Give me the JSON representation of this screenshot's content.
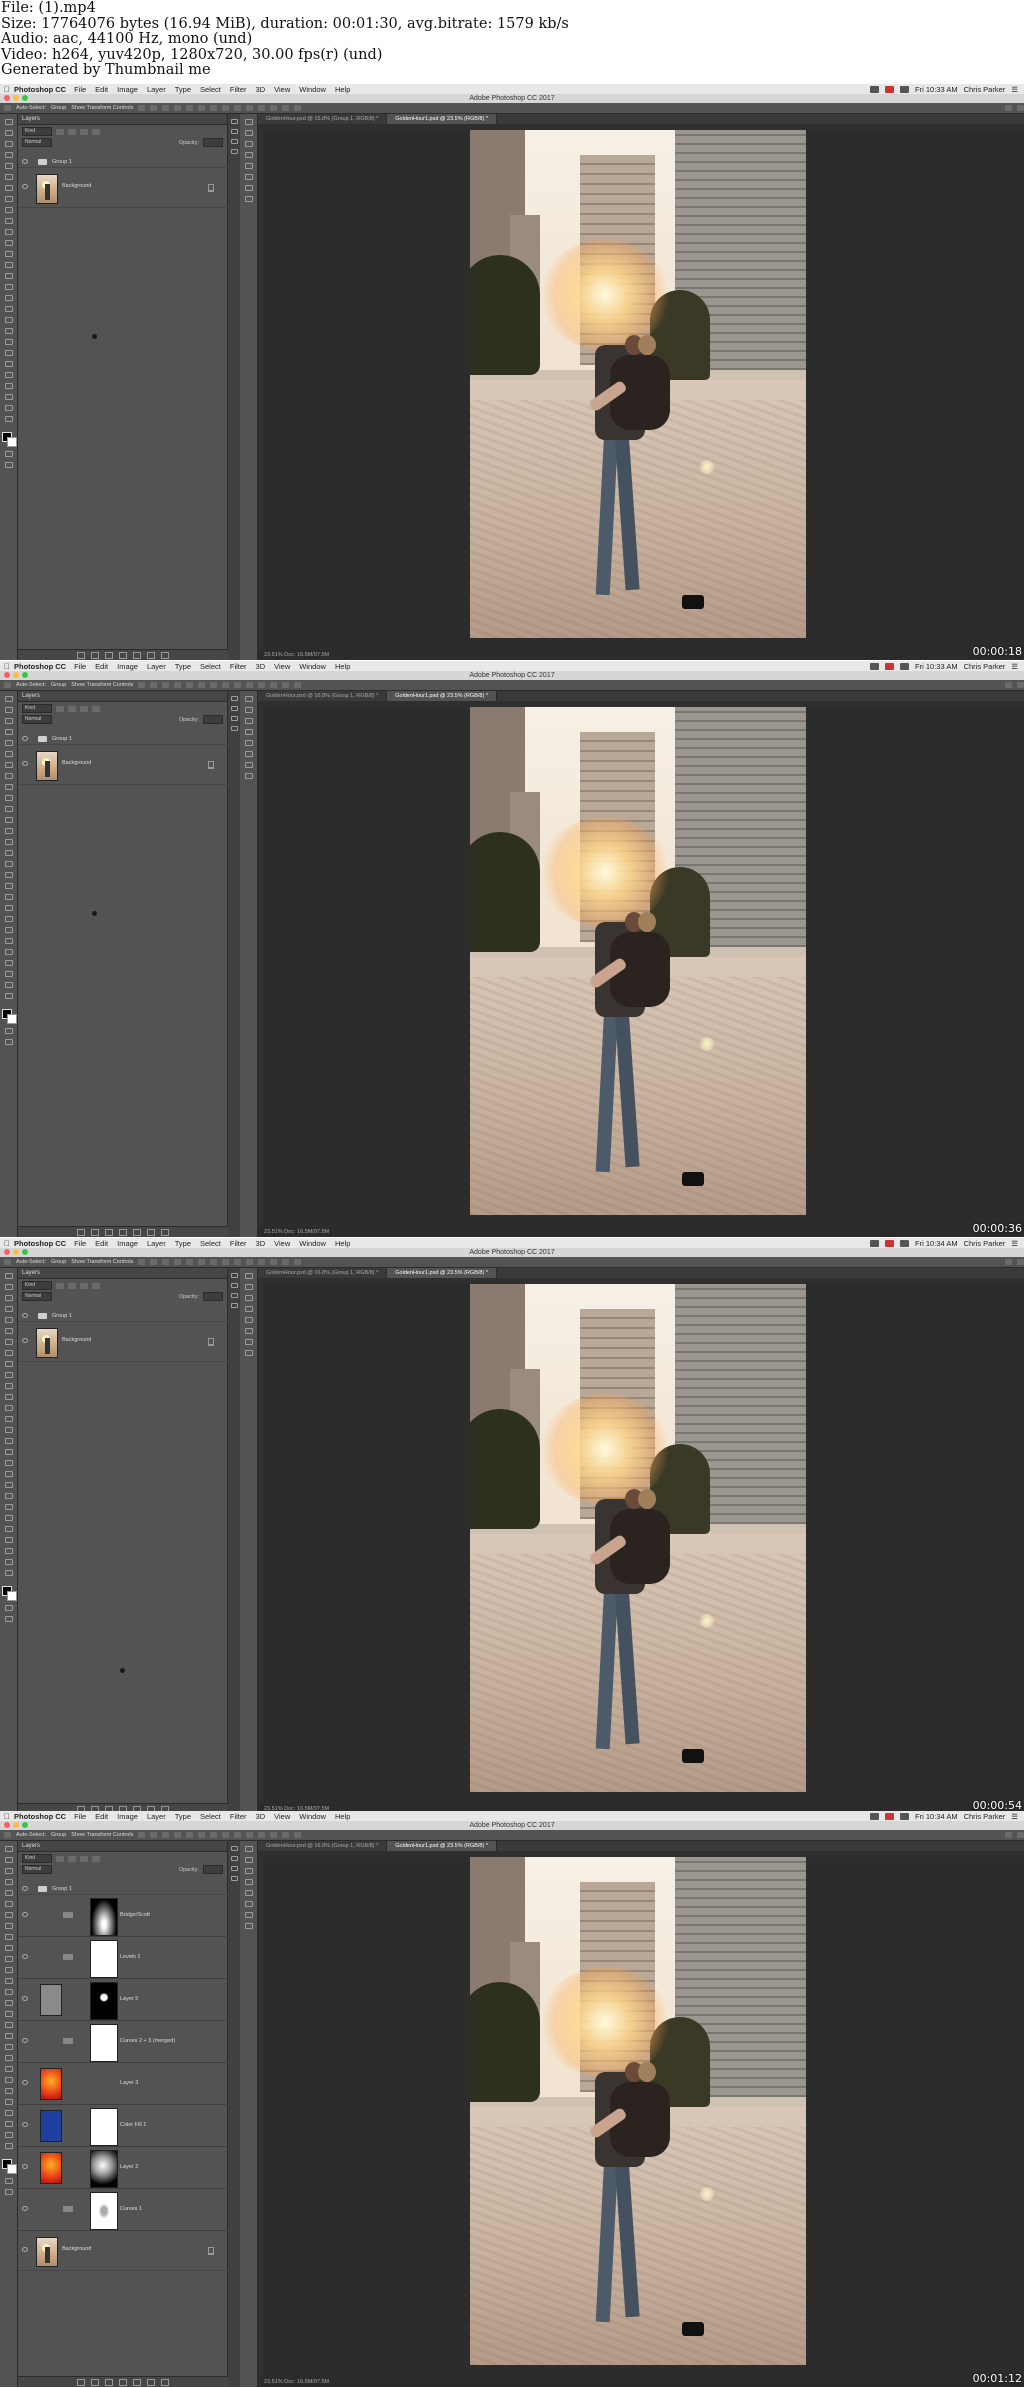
{
  "header": {
    "lines": [
      "File:  (1).mp4",
      "Size: 17764076 bytes (16.94 MiB), duration: 00:01:30, avg.bitrate: 1579 kb/s",
      "Audio: aac, 44100 Hz, mono (und)",
      "Video: h264, yuv420p, 1280x720, 30.00 fps(r) (und)",
      "Generated by Thumbnail me"
    ]
  },
  "app": {
    "app_name": "Photoshop CC",
    "menu": [
      "File",
      "Edit",
      "Image",
      "Layer",
      "Type",
      "Select",
      "Filter",
      "3D",
      "View",
      "Window",
      "Help"
    ],
    "window_title": "Adobe Photoshop CC 2017",
    "user": "Chris Parker",
    "options": [
      "Auto-Select:",
      "Group",
      "Show Transform Controls"
    ],
    "panel_tab": "Layers",
    "kind_label": "Kind",
    "mode": "Normal",
    "opacity_label": "Opacity:",
    "fill_label": "Fill:",
    "doc_tabs": [
      "GoldenHour.psd @ 16.8% (Group 1, RGB/8) *",
      "GoldenHour1.psd @ 23.5% (RGB/8) *"
    ],
    "status": "23.51%      Doc: 16.5M/97.5M"
  },
  "frames": [
    {
      "timestamp": "00:00:18",
      "clock": "Fri 10:33 AM",
      "layers": [
        {
          "name": "Group 1",
          "type": "group"
        },
        {
          "name": "Background",
          "type": "image"
        }
      ]
    },
    {
      "timestamp": "00:00:36",
      "clock": "Fri 10:33 AM",
      "layers": [
        {
          "name": "Group 1",
          "type": "group"
        },
        {
          "name": "Background",
          "type": "image"
        }
      ]
    },
    {
      "timestamp": "00:00:54",
      "clock": "Fri 10:34 AM",
      "layers": [
        {
          "name": "Group 1",
          "type": "group"
        },
        {
          "name": "Background",
          "type": "image"
        }
      ]
    },
    {
      "timestamp": "00:01:12",
      "clock": "Fri 10:34 AM",
      "layers": [
        {
          "name": "Group 1",
          "type": "group"
        },
        {
          "name": "Bridge/Scott",
          "type": "adjust",
          "mask": "vignette"
        },
        {
          "name": "Levels 1",
          "type": "adjust",
          "mask": "white"
        },
        {
          "name": "Layer 5",
          "type": "pixel",
          "mask": "spot"
        },
        {
          "name": "Curves 2 + 3 (merged)",
          "type": "adjust",
          "mask": "white"
        },
        {
          "name": "Layer 3",
          "type": "fire",
          "mask": "none"
        },
        {
          "name": "Color Fill 1",
          "type": "fill",
          "mask": "white"
        },
        {
          "name": "Layer 2",
          "type": "fire",
          "mask": "glow"
        },
        {
          "name": "Curves 1",
          "type": "adjust",
          "mask": "figure"
        },
        {
          "name": "Background",
          "type": "image"
        }
      ]
    }
  ],
  "colors": {
    "fire_thumb": "#e8401a",
    "fill_thumb": "#2040a0"
  }
}
